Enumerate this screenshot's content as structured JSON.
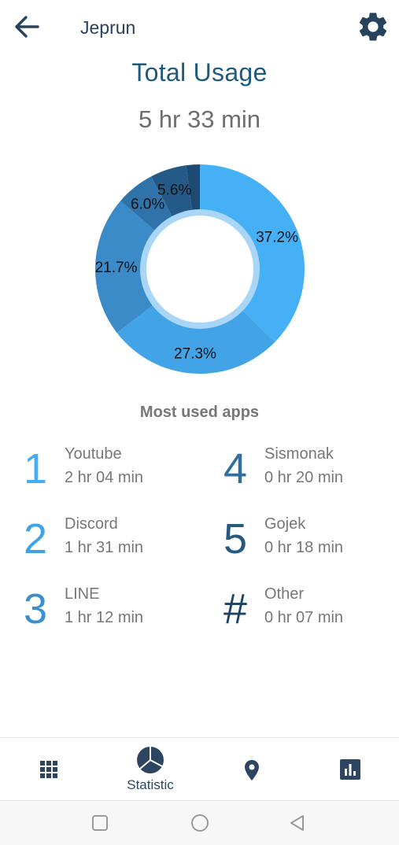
{
  "header": {
    "app_name": "Jeprun"
  },
  "summary": {
    "title": "Total Usage",
    "total": "5 hr 33 min"
  },
  "chart_data": {
    "type": "pie",
    "categories": [
      "Youtube",
      "Discord",
      "LINE",
      "Sismonak",
      "Gojek",
      "Other"
    ],
    "values": [
      37.2,
      27.3,
      21.7,
      6.0,
      5.6,
      2.1
    ],
    "labels": [
      "37.2%",
      "27.3%",
      "21.7%",
      "6.0%",
      "5.6%",
      ""
    ],
    "colors": [
      "#45b0f5",
      "#42a4e6",
      "#3a8bc8",
      "#2f73aa",
      "#245a88",
      "#1d4a70"
    ],
    "donut": true
  },
  "most_used": {
    "title": "Most used apps",
    "apps": [
      {
        "rank": "1",
        "name": "Youtube",
        "time": "2 hr 04 min",
        "color": "#45aef0"
      },
      {
        "rank": "2",
        "name": "Discord",
        "time": "1 hr 31 min",
        "color": "#3fa3e6"
      },
      {
        "rank": "3",
        "name": "LINE",
        "time": "1 hr 12 min",
        "color": "#3a8fcc"
      },
      {
        "rank": "4",
        "name": "Sismonak",
        "time": "0 hr 20 min",
        "color": "#2f6f9e"
      },
      {
        "rank": "5",
        "name": "Gojek",
        "time": "0 hr 18 min",
        "color": "#245a82"
      },
      {
        "rank": "#",
        "name": "Other",
        "time": "0 hr 07 min",
        "color": "#1d4466"
      }
    ]
  },
  "nav": {
    "items": [
      {
        "icon": "grid-icon",
        "label": ""
      },
      {
        "icon": "pie-chart-icon",
        "label": "Statistic"
      },
      {
        "icon": "location-pin-icon",
        "label": ""
      },
      {
        "icon": "bar-chart-icon",
        "label": ""
      }
    ]
  },
  "system_nav": {
    "icons": [
      "recents-square-icon",
      "home-circle-icon",
      "back-triangle-icon"
    ]
  }
}
